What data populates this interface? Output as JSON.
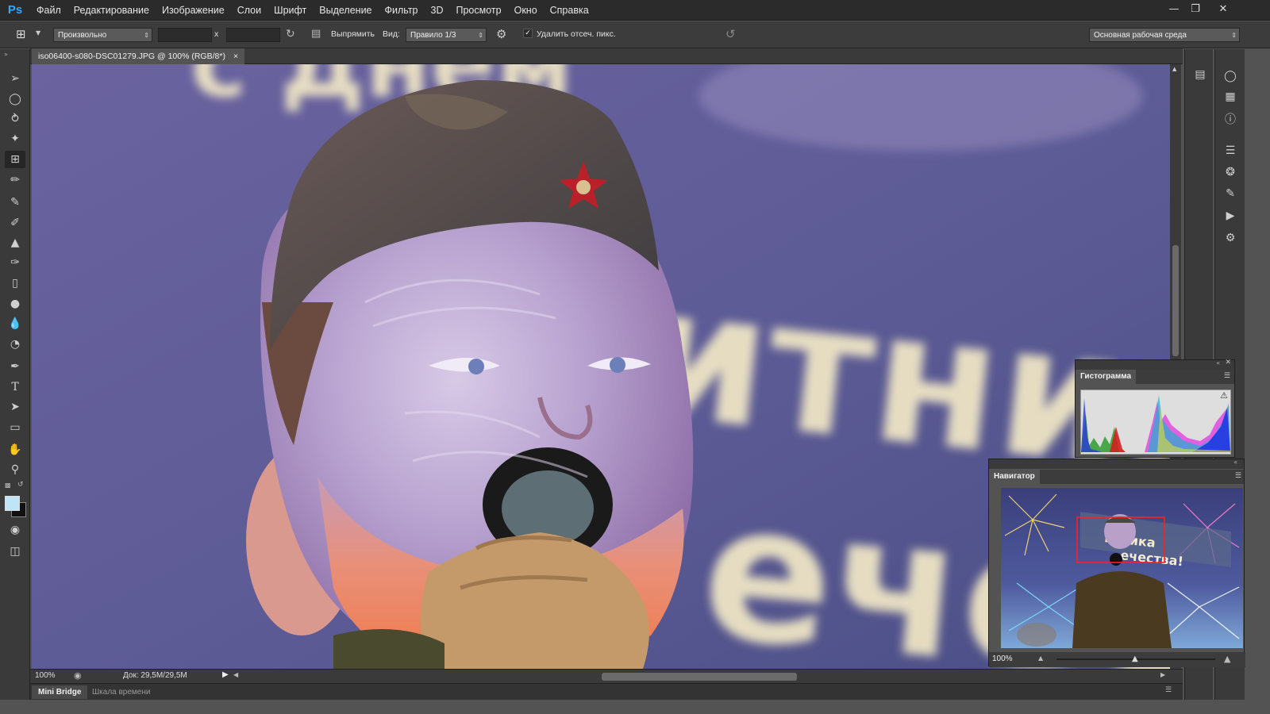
{
  "app": {
    "logo": "Ps"
  },
  "menu": [
    "Файл",
    "Редактирование",
    "Изображение",
    "Слои",
    "Шрифт",
    "Выделение",
    "Фильтр",
    "3D",
    "Просмотр",
    "Окно",
    "Справка"
  ],
  "options": {
    "ratio_preset": "Произвольно",
    "times": "x",
    "straighten_label": "Выпрямить",
    "view_label": "Вид:",
    "view_value": "Правило 1/3",
    "delete_cropped_label": "Удалить отсеч. пикс.",
    "delete_cropped_checked": true,
    "workspace": "Основная рабочая среда"
  },
  "document": {
    "tab_title": "iso06400-s080-DSC01279.JPG @ 100% (RGB/8*)",
    "close": "×"
  },
  "status": {
    "zoom": "100%",
    "doc_info": "Док: 29,5M/29,5M"
  },
  "bottom_tabs": [
    "Mini Bridge",
    "Шкала времени"
  ],
  "histogram": {
    "title": "Гистограмма",
    "warning_icon": "warning-triangle-icon"
  },
  "navigator": {
    "title": "Навигатор",
    "zoom": "100%"
  },
  "colors": {
    "foreground": "#bfe4f8",
    "background": "#111111",
    "accent": "#31a8ff",
    "nav_box": "#ff2020"
  }
}
